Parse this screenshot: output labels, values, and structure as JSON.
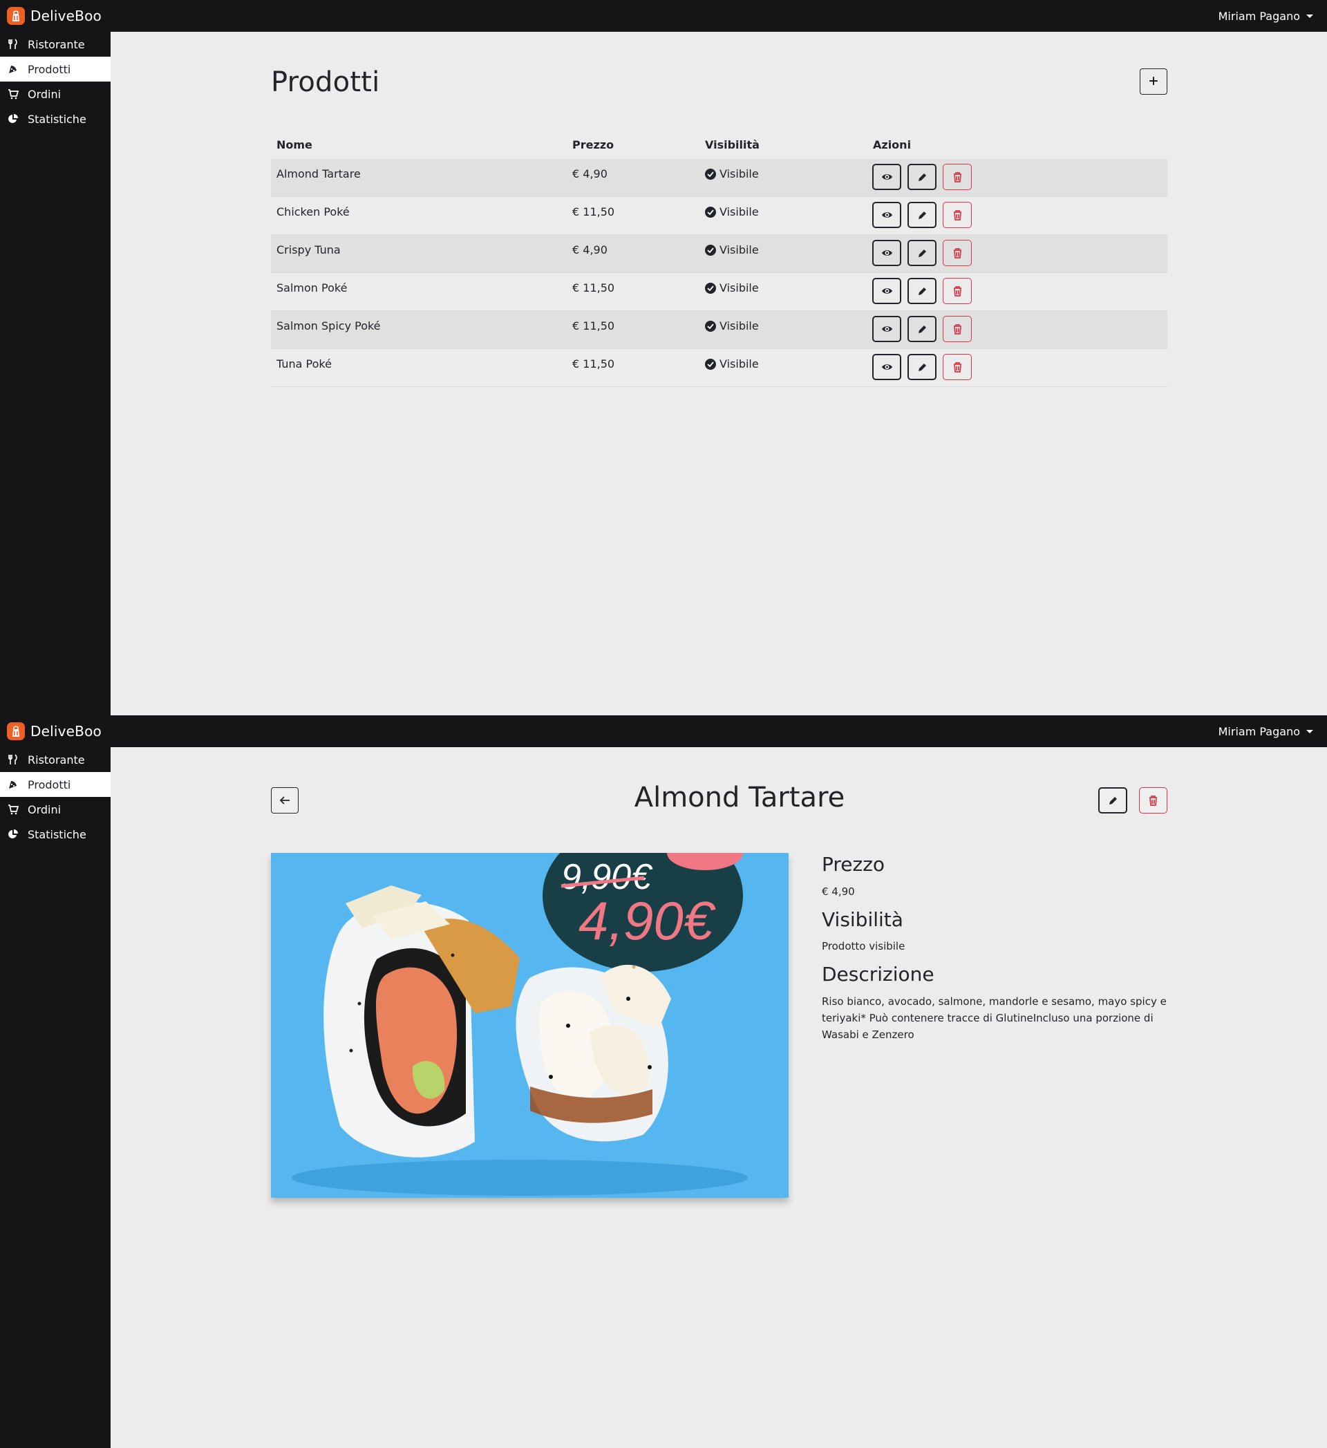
{
  "app": {
    "brand": "DeliveBoo",
    "user": "Miriam Pagano"
  },
  "sidebar": {
    "items": [
      {
        "label": "Ristorante",
        "icon": "utensils-icon"
      },
      {
        "label": "Prodotti",
        "icon": "pizza-slice-icon",
        "active": true
      },
      {
        "label": "Ordini",
        "icon": "cart-icon"
      },
      {
        "label": "Statistiche",
        "icon": "chart-pie-icon"
      }
    ]
  },
  "products_page": {
    "title": "Prodotti",
    "add_label": "+",
    "columns": {
      "name": "Nome",
      "price": "Prezzo",
      "visibility": "Visibilità",
      "actions": "Azioni"
    },
    "rows": [
      {
        "name": "Almond Tartare",
        "price": "€ 4,90",
        "visibility": "Visibile"
      },
      {
        "name": "Chicken Poké",
        "price": "€ 11,50",
        "visibility": "Visibile"
      },
      {
        "name": "Crispy Tuna",
        "price": "€ 4,90",
        "visibility": "Visibile"
      },
      {
        "name": "Salmon Poké",
        "price": "€ 11,50",
        "visibility": "Visibile"
      },
      {
        "name": "Salmon Spicy Poké",
        "price": "€ 11,50",
        "visibility": "Visibile"
      },
      {
        "name": "Tuna Poké",
        "price": "€ 11,50",
        "visibility": "Visibile"
      }
    ]
  },
  "detail_page": {
    "title": "Almond Tartare",
    "price_heading": "Prezzo",
    "price": "€ 4,90",
    "visibility_heading": "Visibilità",
    "visibility": "Prodotto visibile",
    "description_heading": "Descrizione",
    "description": "Riso bianco, avocado, salmone, mandorle e sesamo, mayo spicy e teriyaki* Può contenere tracce di GlutineIncluso una porzione di Wasabi e Zenzero",
    "image_text": {
      "old_price": "9,90€",
      "new_price": "4,90€"
    }
  },
  "colors": {
    "topbar": "#151416",
    "sidebar": "#151416",
    "brand": "#ee5f24",
    "danger": "#dc3545",
    "image_bg": "#59b8f1"
  }
}
